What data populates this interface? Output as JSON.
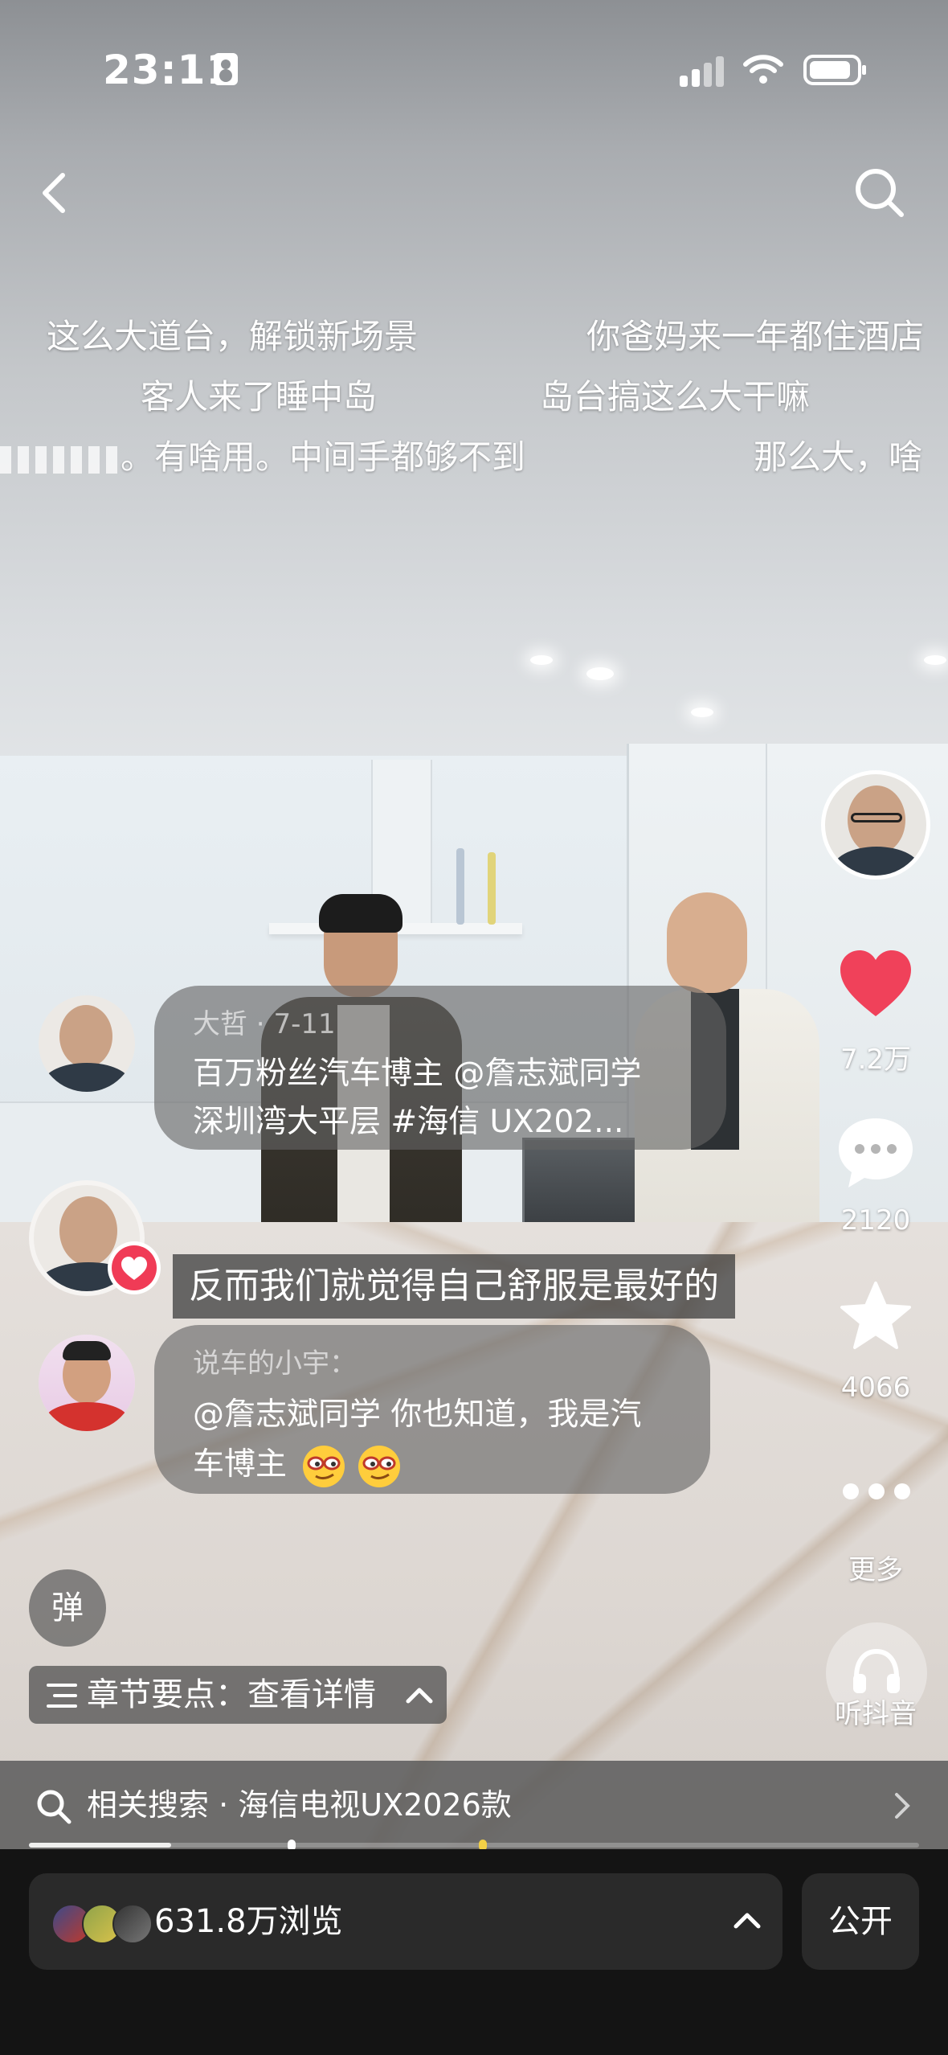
{
  "status_bar": {
    "time": "23:11"
  },
  "danmaku": [
    {
      "text": "这么大道台，解锁新场景"
    },
    {
      "text": "你爸妈来一年都住酒店"
    },
    {
      "text": "客人来了睡中岛"
    },
    {
      "text": "岛台搞这么大干嘛"
    },
    {
      "text": "。有啥用。中间手都够不到"
    },
    {
      "text": "那么大，啥"
    }
  ],
  "actions": {
    "like_count": "7.2万",
    "comment_count": "2120",
    "favorite_count": "4066",
    "more_label": "更多",
    "listen_label": "听抖音"
  },
  "comments": [
    {
      "author": "大哲",
      "date": "7-11",
      "lines": [
        "百万粉丝汽车博主 @詹志斌同学",
        "深圳湾大平层 #海信 UX202..."
      ]
    },
    {
      "highlight": "反而我们就觉得自己舒服是最好的"
    },
    {
      "author": "说车的小宇：",
      "lines": [
        "@詹志斌同学 你也知道，我是汽",
        "车博主"
      ]
    }
  ],
  "controls": {
    "danmu_label": "弹",
    "chapter_label": "章节要点：查看详情"
  },
  "related_search": {
    "text": "相关搜索 · 海信电视UX2026款"
  },
  "progress": {
    "fraction": 0.16
  },
  "footer": {
    "views": "631.8万浏览",
    "public_label": "公开"
  },
  "colors": {
    "like_red": "#f0415a",
    "follow_red": "#f03b56"
  }
}
